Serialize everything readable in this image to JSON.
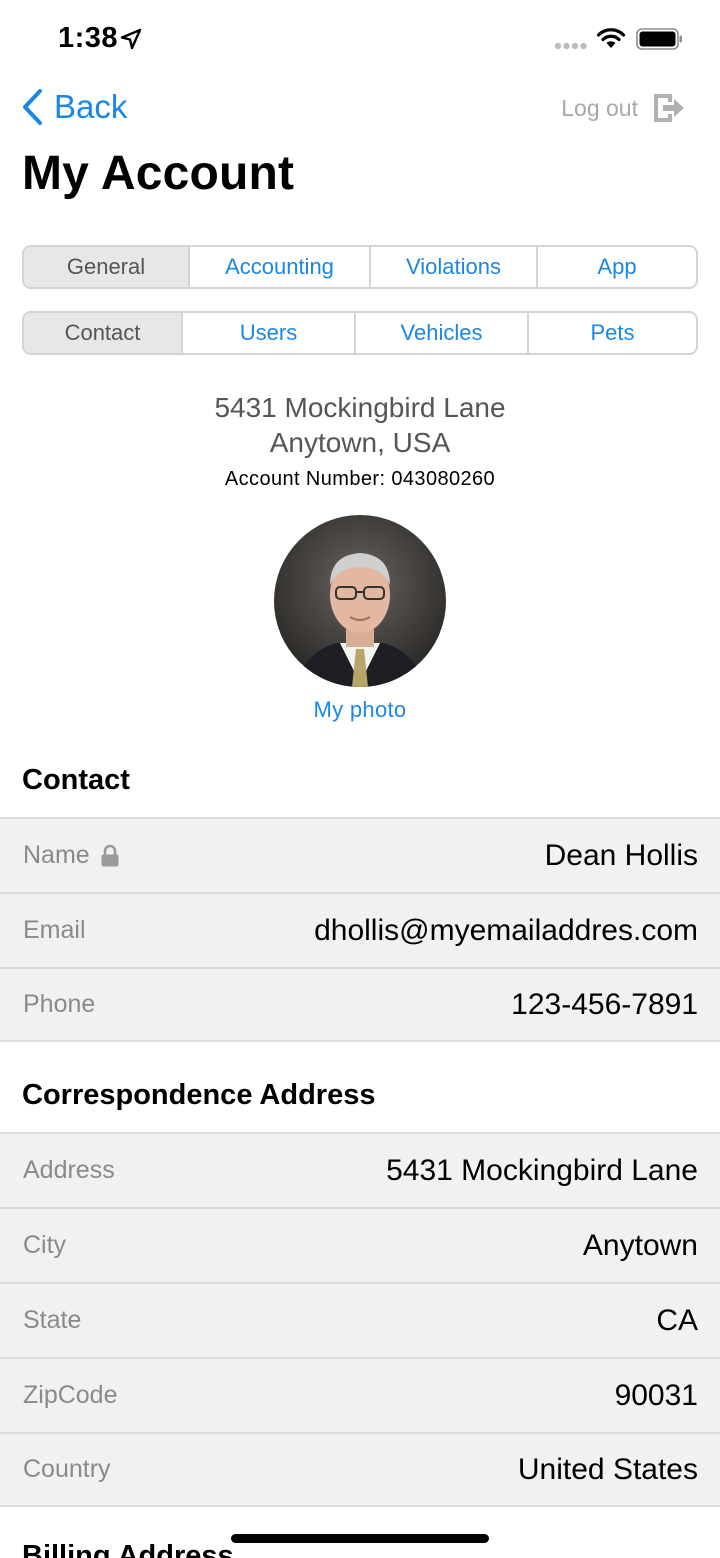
{
  "status_bar": {
    "time": "1:38"
  },
  "nav": {
    "back_label": "Back",
    "logout_label": "Log out",
    "title": "My Account"
  },
  "tabs_top": [
    {
      "label": "General",
      "active": true
    },
    {
      "label": "Accounting",
      "active": false
    },
    {
      "label": "Violations",
      "active": false
    },
    {
      "label": "App",
      "active": false
    }
  ],
  "tabs_bottom": [
    {
      "label": "Contact",
      "active": true
    },
    {
      "label": "Users",
      "active": false
    },
    {
      "label": "Vehicles",
      "active": false
    },
    {
      "label": "Pets",
      "active": false
    }
  ],
  "header": {
    "address_line1": "5431 Mockingbird Lane",
    "address_line2": "Anytown, USA",
    "account_number": "Account Number: 043080260",
    "photo_link": "My photo"
  },
  "contact": {
    "title": "Contact",
    "rows": [
      {
        "label": "Name",
        "value": "Dean Hollis",
        "locked": true
      },
      {
        "label": "Email",
        "value": "dhollis@myemailaddres.com"
      },
      {
        "label": "Phone",
        "value": "123-456-7891"
      }
    ]
  },
  "correspondence": {
    "title": "Correspondence Address",
    "rows": [
      {
        "label": "Address",
        "value": "5431 Mockingbird Lane"
      },
      {
        "label": "City",
        "value": "Anytown"
      },
      {
        "label": "State",
        "value": "CA"
      },
      {
        "label": "ZipCode",
        "value": "90031"
      },
      {
        "label": "Country",
        "value": "United States"
      }
    ]
  },
  "billing": {
    "title": "Billing Address"
  },
  "colors": {
    "accent": "#1a87e6",
    "row_bg": "#f1f1f1",
    "label_gray": "#8a8a8a"
  },
  "icons": [
    "location-arrow-icon",
    "signal-icon",
    "wifi-icon",
    "battery-icon",
    "back-chevron-icon",
    "logout-icon",
    "lock-icon"
  ]
}
